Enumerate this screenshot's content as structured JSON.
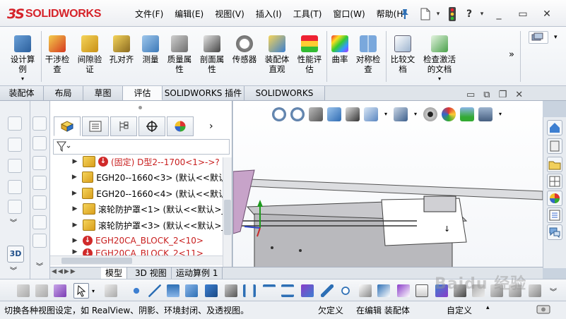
{
  "app": {
    "brand_ds": "3S",
    "brand_name": "SOLIDWORKS"
  },
  "menu": [
    "文件(F)",
    "编辑(E)",
    "视图(V)",
    "插入(I)",
    "工具(T)",
    "窗口(W)",
    "帮助(H)"
  ],
  "quick": {
    "help": "?",
    "min": "_",
    "restore": "▭",
    "close": "✕"
  },
  "command_manager": [
    {
      "label": "设计算\n例"
    },
    {
      "label": "干涉检\n查"
    },
    {
      "label": "间隙验\n证"
    },
    {
      "label": "孔对齐"
    },
    {
      "label": "测量"
    },
    {
      "label": "质量属\n性"
    },
    {
      "label": "剖面属\n性"
    },
    {
      "label": "传感器"
    },
    {
      "label": "装配体\n直观"
    },
    {
      "label": "性能评\n估"
    },
    {
      "label": "曲率"
    },
    {
      "label": "对称检\n查"
    },
    {
      "label": "比较文\n档"
    },
    {
      "label": "检查激活\n的文档"
    }
  ],
  "overflow": "»",
  "tabs": [
    "装配体",
    "布局",
    "草图",
    "评估",
    "SOLIDWORKS 插件",
    "SOLIDWORKS MBD"
  ],
  "active_tab": "评估",
  "tree": [
    {
      "arrow": "▶",
      "err": true,
      "text": "(固定) D型2--1700<1>->?",
      "red": true
    },
    {
      "arrow": "▶",
      "err": false,
      "text": "EGH20--1660<3> (默认<<默认",
      "red": false
    },
    {
      "arrow": "▶",
      "err": false,
      "text": "EGH20--1660<4> (默认<<默认",
      "red": false
    },
    {
      "arrow": "▶",
      "err": false,
      "text": "滚轮防护罩<1> (默认<<默认>_",
      "red": false
    },
    {
      "arrow": "▶",
      "err": false,
      "text": "滚轮防护罩<3> (默认<<默认>_",
      "red": false
    },
    {
      "arrow": "▶",
      "err": true,
      "text": "EGH20CA_BLOCK_2<10>",
      "red": true
    },
    {
      "arrow": "▶",
      "err": true,
      "text": "EGH20CA_BLOCK_2<11>",
      "red": true
    }
  ],
  "bottom_tabs": [
    "模型",
    "3D 视图",
    "运动算例 1"
  ],
  "active_bottom_tab": "模型",
  "view_label_3d": "3D",
  "status": {
    "hint": "切换各种视图设定，如 RealView、阴影、环境封闭、及透视图。",
    "under_defined": "欠定义",
    "editing": "在编辑 装配体",
    "custom": "自定义"
  },
  "watermark": "Baidu 经验",
  "colors": {
    "brand_red": "#d6232a",
    "error_red": "#c81e1e",
    "accent_blue": "#2d6fb5"
  }
}
